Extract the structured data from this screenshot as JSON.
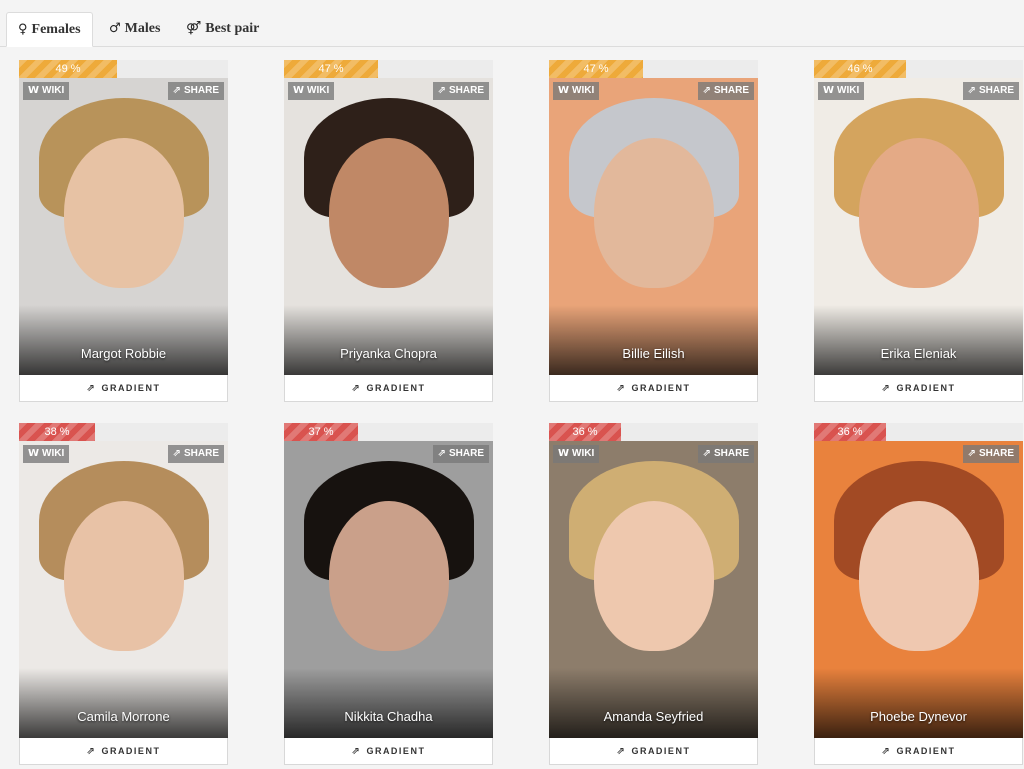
{
  "tabs": [
    {
      "label": "Females",
      "symbol": "♀",
      "active": true
    },
    {
      "label": "Males",
      "symbol": "♂",
      "active": false
    },
    {
      "label": "Best pair",
      "symbol": "⚤",
      "active": false
    }
  ],
  "card_labels": {
    "wiki": "WIKI",
    "share": "SHARE",
    "gradient": "GRADIENT"
  },
  "colors": {
    "orange": "#eeaa3a",
    "red": "#d9534f"
  },
  "cards": [
    {
      "name": "Margot Robbie",
      "percent_label": "49 %",
      "percent": 49,
      "level": "orange",
      "has_wiki": true,
      "palette": {
        "bg": "#d6d4d2",
        "hair": "#b8935a",
        "skin": "#e7c2a4"
      }
    },
    {
      "name": "Priyanka Chopra",
      "percent_label": "47 %",
      "percent": 47,
      "level": "orange",
      "has_wiki": true,
      "palette": {
        "bg": "#e5e2de",
        "hair": "#2e2019",
        "skin": "#c08866"
      }
    },
    {
      "name": "Billie Eilish",
      "percent_label": "47 %",
      "percent": 47,
      "level": "orange",
      "has_wiki": true,
      "palette": {
        "bg": "#e9a479",
        "hair": "#c5c7cc",
        "skin": "#e2b89b"
      }
    },
    {
      "name": "Erika Eleniak",
      "percent_label": "46 %",
      "percent": 46,
      "level": "orange",
      "has_wiki": true,
      "palette": {
        "bg": "#f0ece6",
        "hair": "#d4a45e",
        "skin": "#e4aa86"
      }
    },
    {
      "name": "Camila Morrone",
      "percent_label": "38 %",
      "percent": 38,
      "level": "red",
      "has_wiki": true,
      "palette": {
        "bg": "#ece9e6",
        "hair": "#b58d5c",
        "skin": "#e8c2a6"
      }
    },
    {
      "name": "Nikkita Chadha",
      "percent_label": "37 %",
      "percent": 37,
      "level": "red",
      "has_wiki": false,
      "palette": {
        "bg": "#9e9e9e",
        "hair": "#17120f",
        "skin": "#caa08a"
      }
    },
    {
      "name": "Amanda Seyfried",
      "percent_label": "36 %",
      "percent": 36,
      "level": "red",
      "has_wiki": true,
      "palette": {
        "bg": "#8d7d6b",
        "hair": "#cfae73",
        "skin": "#eec8ae"
      }
    },
    {
      "name": "Phoebe Dynevor",
      "percent_label": "36 %",
      "percent": 36,
      "level": "red",
      "has_wiki": false,
      "palette": {
        "bg": "#e9823d",
        "hair": "#a24a24",
        "skin": "#efc8b0"
      }
    }
  ]
}
